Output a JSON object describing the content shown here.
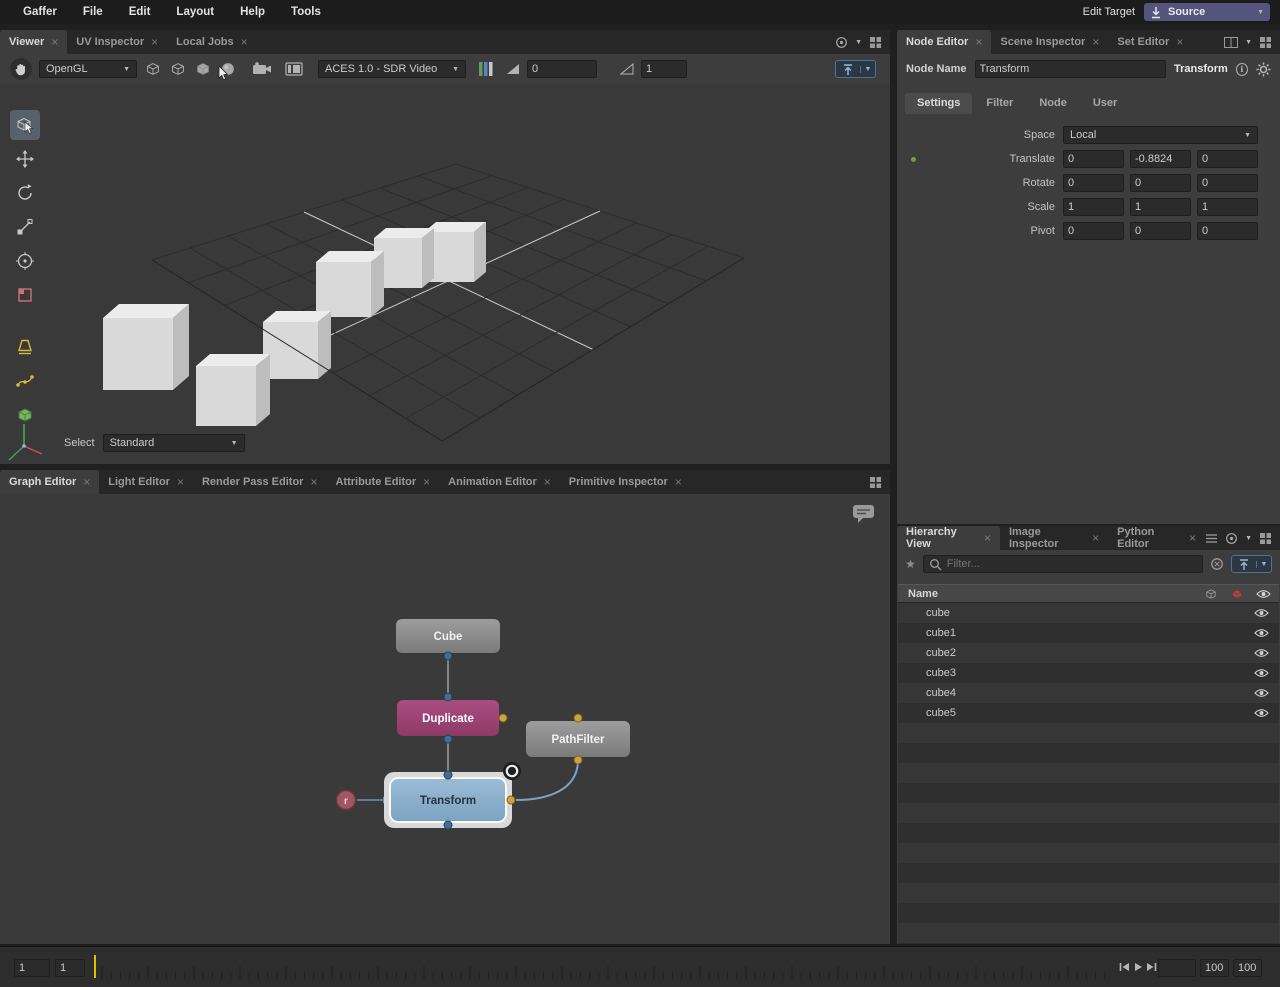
{
  "colors": {
    "accent_blue": "#7aa3c2",
    "node_magenta": "#a84e80",
    "connector_yellow": "#cda43c",
    "connector_blue": "#3f6d99",
    "current_frame_yellow": "#e0c000",
    "edit_target_purple": "#54547c"
  },
  "menubar": {
    "items": [
      "Gaffer",
      "File",
      "Edit",
      "Layout",
      "Help",
      "Tools"
    ],
    "edit_target_label": "Edit Target",
    "edit_target_value": "Source"
  },
  "viewer": {
    "tabs": [
      "Viewer",
      "UV Inspector",
      "Local Jobs"
    ],
    "renderer": "OpenGL",
    "display_transform": "ACES 1.0 - SDR Video",
    "exposure": "0",
    "gamma": "1",
    "select_label": "Select",
    "select_value": "Standard"
  },
  "graph_editor": {
    "tabs": [
      "Graph Editor",
      "Light Editor",
      "Render Pass Editor",
      "Attribute Editor",
      "Animation Editor",
      "Primitive Inspector"
    ],
    "nodes": {
      "cube": "Cube",
      "duplicate": "Duplicate",
      "pathfilter": "PathFilter",
      "transform": "Transform",
      "r": "r"
    }
  },
  "node_editor": {
    "tabs": [
      "Node Editor",
      "Scene Inspector",
      "Set Editor"
    ],
    "node_name_label": "Node Name",
    "node_name_value": "Transform",
    "node_type": "Transform",
    "sub_tabs": [
      "Settings",
      "Filter",
      "Node",
      "User"
    ],
    "space": {
      "label": "Space",
      "value": "Local"
    },
    "translate": {
      "label": "Translate",
      "values": [
        "0",
        "-0.8824",
        "0"
      ]
    },
    "rotate": {
      "label": "Rotate",
      "values": [
        "0",
        "0",
        "0"
      ]
    },
    "scale": {
      "label": "Scale",
      "values": [
        "1",
        "1",
        "1"
      ]
    },
    "pivot": {
      "label": "Pivot",
      "values": [
        "0",
        "0",
        "0"
      ]
    }
  },
  "hierarchy": {
    "tabs": [
      "Hierarchy View",
      "Image Inspector",
      "Python Editor"
    ],
    "filter_placeholder": "Filter...",
    "name_header": "Name",
    "rows": [
      "cube",
      "cube1",
      "cube2",
      "cube3",
      "cube4",
      "cube5"
    ]
  },
  "timeline": {
    "start_frame": "1",
    "range_start": "1",
    "range_end": "100",
    "end_frame": "100"
  }
}
